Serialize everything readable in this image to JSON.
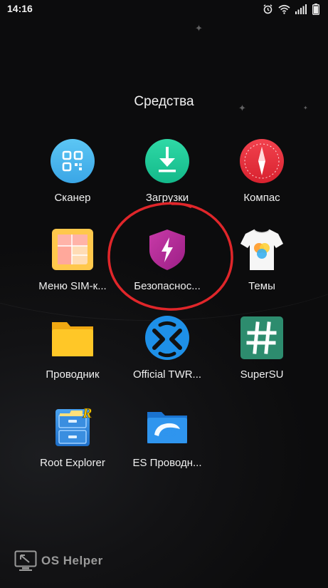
{
  "status_bar": {
    "time": "14:16",
    "icons": [
      "alarm-icon",
      "wifi-icon",
      "signal-icon",
      "battery-icon"
    ]
  },
  "folder": {
    "title": "Средства",
    "apps": [
      {
        "label": "Сканер",
        "icon": "scanner-icon",
        "color": "#4ab6ee"
      },
      {
        "label": "Загрузки",
        "icon": "download-icon",
        "color": "#1fc99a"
      },
      {
        "label": "Компас",
        "icon": "compass-icon",
        "color": "#e52f3c"
      },
      {
        "label": "Меню SIM-к...",
        "icon": "sim-menu-icon",
        "color": "#ffc84c"
      },
      {
        "label": "Безопаснос...",
        "icon": "security-shield-icon",
        "color": "#b8279c"
      },
      {
        "label": "Темы",
        "icon": "themes-tshirt-icon",
        "color": "#f4f4f4"
      },
      {
        "label": "Проводник",
        "icon": "folder-icon",
        "color": "#ffc21c"
      },
      {
        "label": "Official TWR...",
        "icon": "twrp-icon",
        "color": "#1b8ee6"
      },
      {
        "label": "SuperSU",
        "icon": "supersu-hash-icon",
        "color": "#2d8c6e"
      },
      {
        "label": "Root Explorer",
        "icon": "root-explorer-cabinet-icon",
        "color": "#2a86e0"
      },
      {
        "label": "ES Проводн...",
        "icon": "es-explorer-icon",
        "color": "#2b8fe8"
      }
    ]
  },
  "highlight": {
    "color": "#e0262a",
    "target": "Безопаснос..."
  },
  "watermark": {
    "text": "OS Helper",
    "icon": "os-helper-logo-icon"
  }
}
